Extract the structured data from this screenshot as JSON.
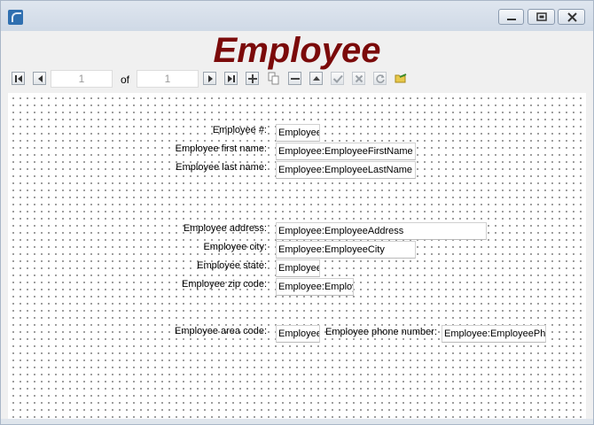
{
  "window": {
    "title": ""
  },
  "form": {
    "title": "Employee"
  },
  "navigator": {
    "current_record": "1",
    "of_label": "of",
    "total_records": "1",
    "buttons": [
      "first-record",
      "previous-record",
      "next-record",
      "last-record",
      "add-record",
      "copy-record",
      "delete-record",
      "edit-record",
      "post-record",
      "cancel-record",
      "refresh",
      "search"
    ]
  },
  "fields": {
    "employee_number": {
      "label": "Employee #:",
      "value": "Employee:EmployeeNumber"
    },
    "first_name": {
      "label": "Employee first name:",
      "value": "Employee:EmployeeFirstName"
    },
    "last_name": {
      "label": "Employee last name:",
      "value": "Employee:EmployeeLastName"
    },
    "address": {
      "label": "Employee address:",
      "value": "Employee:EmployeeAddress"
    },
    "city": {
      "label": "Employee city:",
      "value": "Employee:EmployeeCity"
    },
    "state": {
      "label": "Employee state:",
      "value": "Employee:EmployeeState"
    },
    "zip_code": {
      "label": "Employee zip code:",
      "value": "Employee:EmployeeZipCode"
    },
    "area_code": {
      "label": "Employee area code:",
      "value": "Employee:EmployeeAreaCode"
    },
    "phone_number": {
      "label": "Employee phone number:",
      "value": "Employee:EmployeePhoneNumber"
    }
  },
  "colors": {
    "title": "#7b0a0a",
    "window_chrome": "#dfe6ef",
    "canvas": "#ffffff"
  }
}
